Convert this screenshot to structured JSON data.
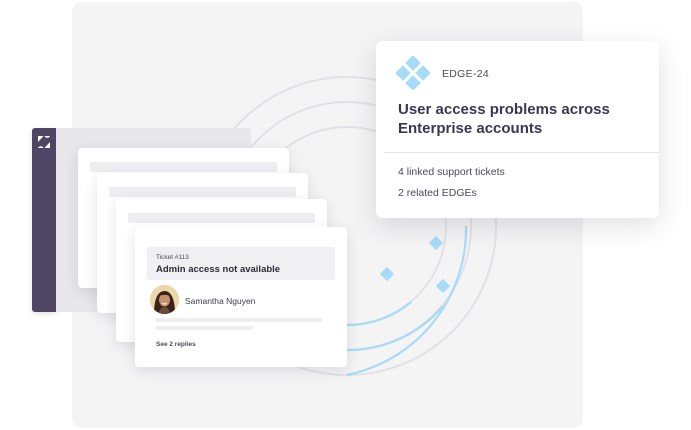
{
  "ticket": {
    "number": "Ticket #113",
    "title": "Admin access not available",
    "user_name": "Samantha Nguyen",
    "replies_link": "See 2 replies"
  },
  "edge": {
    "id": "EDGE-24",
    "title": "User access problems across Enterprise accounts",
    "linked_tickets": "4 linked support tickets",
    "related_edges": "2 related EDGEs"
  },
  "icons": {
    "zendesk": "zendesk-logo-icon",
    "edge": "diamond-cluster-logo-icon",
    "connector": "diamond-node-icon"
  },
  "colors": {
    "accent": "#a8dbf7",
    "sidebar": "#4f4564",
    "title": "#3b3652"
  }
}
